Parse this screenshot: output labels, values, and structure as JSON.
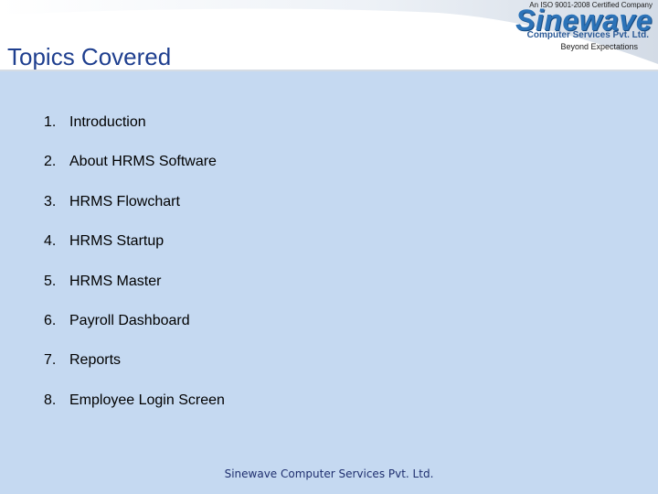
{
  "header": {
    "title": "Topics Covered"
  },
  "logo": {
    "certification": "An ISO 9001-2008 Certified Company",
    "brand": "Sinewave",
    "company": "Computer Services Pvt. Ltd.",
    "tagline": "Beyond Expectations"
  },
  "topics": [
    {
      "number": "1.",
      "label": "Introduction"
    },
    {
      "number": "2.",
      "label": "About HRMS Software"
    },
    {
      "number": "3.",
      "label": "HRMS Flowchart"
    },
    {
      "number": "4.",
      "label": "HRMS Startup"
    },
    {
      "number": "5.",
      "label": "HRMS Master"
    },
    {
      "number": "6.",
      "label": "Payroll Dashboard"
    },
    {
      "number": "7.",
      "label": "Reports"
    },
    {
      "number": "8.",
      "label": "Employee Login Screen"
    }
  ],
  "footer": {
    "text": "Sinewave Computer Services Pvt. Ltd."
  },
  "colors": {
    "content_background": "#c5d9f1",
    "title": "#1f3f8f",
    "brand": "#2c73b8"
  }
}
